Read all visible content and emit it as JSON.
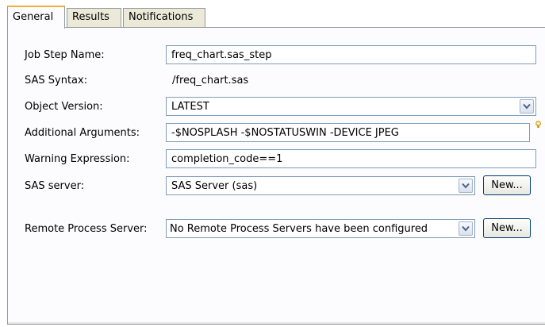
{
  "tabs": [
    {
      "label": "General"
    },
    {
      "label": "Results"
    },
    {
      "label": "Notifications"
    }
  ],
  "form": {
    "job_step_name": {
      "label": "Job Step Name:",
      "value": "freq_chart.sas_step"
    },
    "sas_syntax": {
      "label": "SAS Syntax:",
      "value": "/freq_chart.sas"
    },
    "object_version": {
      "label": "Object Version:",
      "value": "LATEST"
    },
    "additional_arguments": {
      "label": "Additional Arguments:",
      "value": "-$NOSPLASH -$NOSTATUSWIN -DEVICE JPEG"
    },
    "warning_expression": {
      "label": "Warning Expression:",
      "value": "completion_code==1"
    },
    "sas_server": {
      "label": "SAS server:",
      "value": "SAS Server (sas)",
      "new_label": "New..."
    },
    "remote_process_server": {
      "label": "Remote Process Server:",
      "value": "No Remote Process Servers have been configured",
      "new_label": "New..."
    }
  },
  "colors": {
    "active_tab_accent": "#f2b13a",
    "field_border": "#7f9db9",
    "button_border": "#003c74"
  },
  "icons": {
    "dropdown": "chevron-down-icon",
    "hint": "lightbulb-icon"
  }
}
